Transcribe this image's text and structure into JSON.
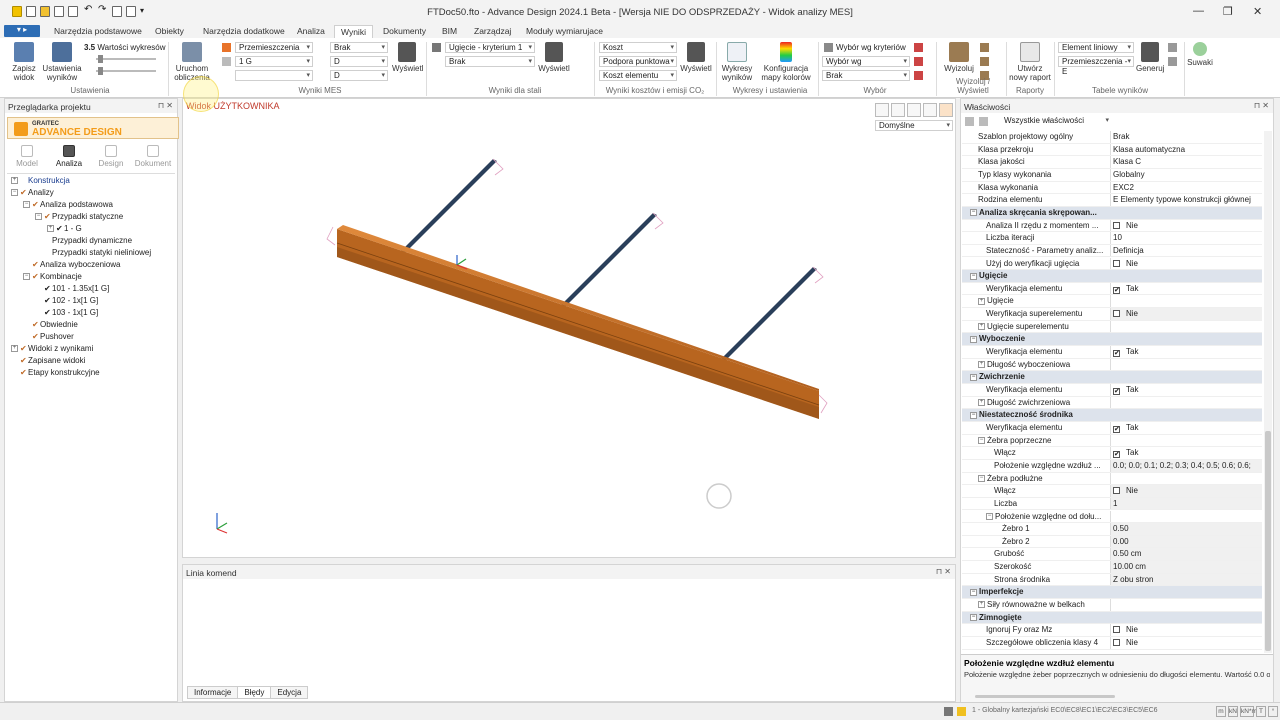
{
  "window": {
    "title": "FTDoc50.fto - Advance Design 2024.1 Beta - [Wersja NIE DO ODSPRZEDAŻY - Widok analizy MES]"
  },
  "ribbon_tabs": [
    {
      "label": "Narzędzia podstawowe"
    },
    {
      "label": "Obiekty"
    },
    {
      "label": "Narzędzia dodatkowe"
    },
    {
      "label": "Analiza"
    },
    {
      "label": "Wyniki"
    },
    {
      "label": "Dokumenty"
    },
    {
      "label": "BIM"
    },
    {
      "label": "Zarządzaj"
    },
    {
      "label": "Moduły wymiarujace"
    }
  ],
  "active_tab": "Wyniki",
  "ribbon": {
    "ustawienia": {
      "save_views": "Zapisz\nwidok",
      "result_settings": "Ustawienia\nwyników",
      "graph_values": "Wartości wykresów",
      "group": "Ustawienia"
    },
    "mes": {
      "run": "Uruchom\nobliczenia",
      "dd_top": "Przemieszczenia",
      "dd_case": "1 G",
      "dd_brak": "Brak",
      "dd_d1": "D",
      "dd_d2": "D",
      "show": "Wyświetl",
      "group": "Wyniki MES"
    },
    "stal": {
      "dd1": "Ugięcie - kryterium 1",
      "dd2": "Brak",
      "show": "Wyświetl",
      "group": "Wyniki dla stali"
    },
    "koszt": {
      "dd1": "Koszt",
      "dd2": "Podpora punktowa",
      "dd3": "Koszt elementu",
      "show": "Wyświetl",
      "group": "Wyniki kosztów i emisji CO₂"
    },
    "wykresy": {
      "b1": "Wykresy\nwyników",
      "b2": "Konfiguracja\nmapy kolorów",
      "group": "Wykresy i ustawienia"
    },
    "wybor": {
      "dd1": "Wybór wg kryteriów",
      "dd2": "Wybór wg",
      "dd3": "Brak",
      "group": "Wybór"
    },
    "wyzoluj": {
      "b1": "Wyizoluj",
      "group": "Wyizoluj / Wyświetl"
    },
    "raporty": {
      "b1": "Utwórz\nnowy raport",
      "group": "Raporty"
    },
    "tabele": {
      "dd1": "Element liniowy",
      "dd2": "Przemieszczenia - E",
      "b1": "Generuj",
      "group": "Tabele wyników"
    },
    "suwaki": {
      "b1": "Suwaki"
    }
  },
  "browser": {
    "title": "Przeglądarka projektu",
    "logo_top": "GRAITEC",
    "logo_main": "ADVANCE DESIGN",
    "nav": [
      {
        "label": "Model"
      },
      {
        "label": "Analiza"
      },
      {
        "label": "Design"
      },
      {
        "label": "Dokument"
      }
    ],
    "tree": [
      {
        "label": "Konstrukcja",
        "lvl": 0,
        "exp": "+",
        "tick": false,
        "link": true
      },
      {
        "label": "Analizy",
        "lvl": 0,
        "exp": "−",
        "tick": true
      },
      {
        "label": "Analiza podstawowa",
        "lvl": 1,
        "exp": "−",
        "tick": true
      },
      {
        "label": "Przypadki statyczne",
        "lvl": 2,
        "exp": "−",
        "tick": true
      },
      {
        "label": "1 - G",
        "lvl": 3,
        "exp": "+",
        "tick": true,
        "black": true
      },
      {
        "label": "Przypadki dynamiczne",
        "lvl": 2,
        "exp": "",
        "tick": false
      },
      {
        "label": "Przypadki statyki nieliniowej",
        "lvl": 2,
        "exp": "",
        "tick": false
      },
      {
        "label": "Analiza wyboczeniowa",
        "lvl": 1,
        "exp": "",
        "tick": true
      },
      {
        "label": "Kombinacje",
        "lvl": 1,
        "exp": "−",
        "tick": true
      },
      {
        "label": "101 - 1.35x[1 G]",
        "lvl": 2,
        "exp": "",
        "tick": true,
        "black": true
      },
      {
        "label": "102 - 1x[1 G]",
        "lvl": 2,
        "exp": "",
        "tick": true,
        "black": true
      },
      {
        "label": "103 - 1x[1 G]",
        "lvl": 2,
        "exp": "",
        "tick": true,
        "black": true
      },
      {
        "label": "Obwiednie",
        "lvl": 1,
        "exp": "",
        "tick": true
      },
      {
        "label": "Pushover",
        "lvl": 1,
        "exp": "",
        "tick": true
      },
      {
        "label": "Widoki z wynikami",
        "lvl": 0,
        "exp": "+",
        "tick": true
      },
      {
        "label": "Zapisane widoki",
        "lvl": 0,
        "exp": "",
        "tick": true
      },
      {
        "label": "Etapy konstrukcyjne",
        "lvl": 0,
        "exp": "",
        "tick": true
      }
    ]
  },
  "viewport": {
    "title": "Widok UŻYTKOWNIKA",
    "view_select": "Domyślne"
  },
  "command": {
    "title": "Linia komend",
    "tabs": [
      {
        "label": "Informacje"
      },
      {
        "label": "Błędy"
      },
      {
        "label": "Edycja"
      }
    ]
  },
  "properties": {
    "title": "Właściwości",
    "filter": "Wszystkie właściwości",
    "rows": [
      {
        "l": "Szablon projektowy ogólny",
        "v": "Brak",
        "i": 2
      },
      {
        "l": "Klasa przekroju",
        "v": "Klasa automatyczna",
        "i": 2
      },
      {
        "l": "Klasa jakości",
        "v": "Klasa C",
        "i": 2
      },
      {
        "l": "Typ klasy wykonania",
        "v": "Globalny",
        "i": 2
      },
      {
        "l": "Klasa wykonania",
        "v": "EXC2",
        "i": 2
      },
      {
        "l": "Rodzina elementu",
        "v": "E Elementy typowe konstrukcji głównej",
        "i": 2
      },
      {
        "l": "Analiza skręcania skrępowan...",
        "cat": true,
        "i": 1
      },
      {
        "l": "Analiza II rzędu z momentem ...",
        "v": "Nie",
        "cb": false,
        "i": 3
      },
      {
        "l": "Liczba iteracji",
        "v": "10",
        "i": 3
      },
      {
        "l": "Stateczność - Parametry analiz...",
        "v": "Definicja",
        "i": 3
      },
      {
        "l": "Użyj do weryfikacji ugięcia",
        "v": "Nie",
        "cb": false,
        "i": 3
      },
      {
        "l": "Ugięcie",
        "cat": true,
        "i": 1
      },
      {
        "l": "Weryfikacja elementu",
        "v": "Tak",
        "cb": true,
        "i": 3
      },
      {
        "l": "Ugięcie",
        "v": "",
        "i": 2,
        "exp": "+"
      },
      {
        "l": "Weryfikacja superelementu",
        "v": "Nie",
        "cb": false,
        "i": 3,
        "gray": true
      },
      {
        "l": "Ugięcie superelementu",
        "v": "",
        "i": 2,
        "exp": "+"
      },
      {
        "l": "Wyboczenie",
        "cat": true,
        "i": 1
      },
      {
        "l": "Weryfikacja elementu",
        "v": "Tak",
        "cb": true,
        "i": 3
      },
      {
        "l": "Długość wyboczeniowa",
        "v": "",
        "i": 2,
        "exp": "+"
      },
      {
        "l": "Zwichrzenie",
        "cat": true,
        "i": 1
      },
      {
        "l": "Weryfikacja elementu",
        "v": "Tak",
        "cb": true,
        "i": 3
      },
      {
        "l": "Długość zwichrzeniowa",
        "v": "",
        "i": 2,
        "exp": "+"
      },
      {
        "l": "Niestateczność środnika",
        "cat": true,
        "i": 1
      },
      {
        "l": "Weryfikacja elementu",
        "v": "Tak",
        "cb": true,
        "i": 3
      },
      {
        "l": "Żebra poprzeczne",
        "v": "",
        "i": 2,
        "exp": "−"
      },
      {
        "l": "Włącz",
        "v": "Tak",
        "cb": true,
        "i": 4
      },
      {
        "l": "Położenie względne wzdłuż ...",
        "v": "0.0; 0.0; 0.1; 0.2; 0.3; 0.4; 0.5; 0.6; 0.6;",
        "i": 4,
        "gray": true
      },
      {
        "l": "Żebra podłużne",
        "v": "",
        "i": 2,
        "exp": "−"
      },
      {
        "l": "Włącz",
        "v": "Nie",
        "cb": false,
        "i": 4,
        "gray": true
      },
      {
        "l": "Liczba",
        "v": "1",
        "i": 4,
        "gray": true
      },
      {
        "l": "Położenie względne od dołu...",
        "v": "",
        "i": 3,
        "exp": "−"
      },
      {
        "l": "Żebro 1",
        "v": "0.50",
        "i": 5,
        "gray": true
      },
      {
        "l": "Żebro 2",
        "v": "0.00",
        "i": 5,
        "gray": true
      },
      {
        "l": "Grubość",
        "v": "0.50 cm",
        "i": 4,
        "gray": true
      },
      {
        "l": "Szerokość",
        "v": "10.00 cm",
        "i": 4,
        "gray": true
      },
      {
        "l": "Strona środnika",
        "v": "Z obu stron",
        "i": 4,
        "gray": true
      },
      {
        "l": "Imperfekcje",
        "cat": true,
        "i": 1
      },
      {
        "l": "Siły równoważne w belkach",
        "v": "",
        "i": 2,
        "exp": "+"
      },
      {
        "l": "Zimnogięte",
        "cat": true,
        "i": 1
      },
      {
        "l": "Ignoruj Fy oraz Mz",
        "v": "Nie",
        "cb": false,
        "i": 3
      },
      {
        "l": "Szczegółowe obliczenia klasy 4",
        "v": "Nie",
        "cb": false,
        "i": 3
      }
    ],
    "desc_title": "Położenie względne wzdłuż elementu",
    "desc_text": "Położenie względne żeber poprzecznych w odniesieniu do długości elementu. Wartość 0.0 ozn"
  },
  "status": {
    "text": "1 - Globalny kartezjański  EC0\\EC8\\EC1\\EC2\\EC3\\EC5\\EC6",
    "units": [
      "m",
      "kN",
      "kN*m",
      "T",
      "°"
    ]
  }
}
